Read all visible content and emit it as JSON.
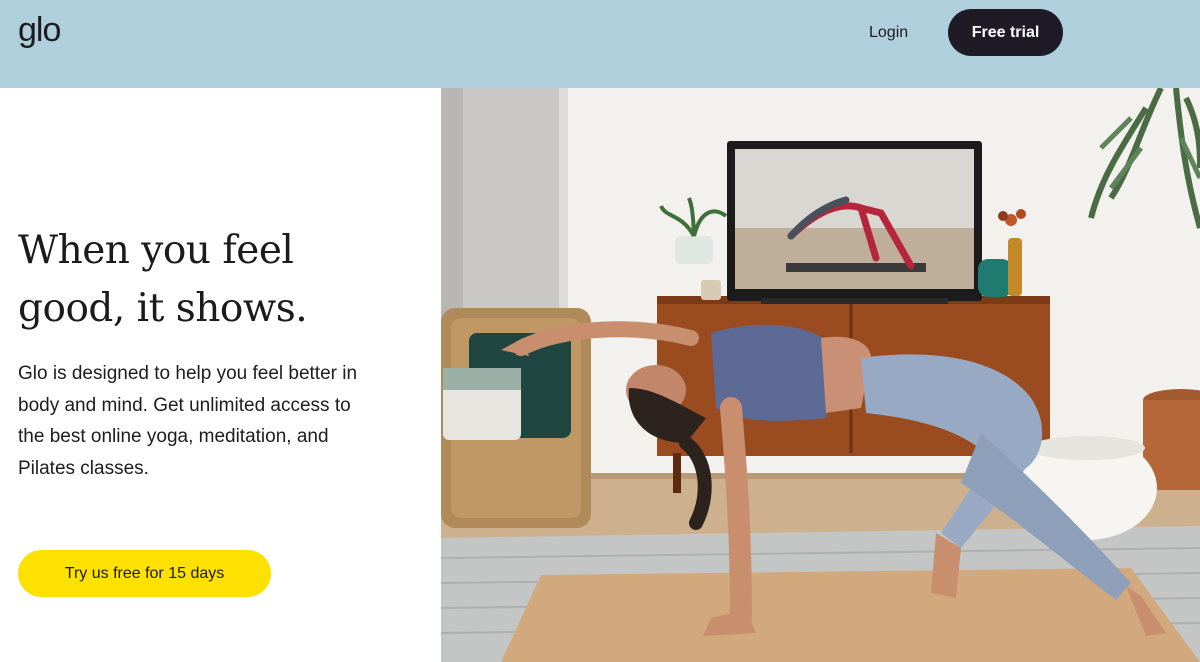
{
  "header": {
    "logo_text": "glo",
    "login_label": "Login",
    "free_trial_label": "Free trial"
  },
  "hero": {
    "headline_line1": "When you feel",
    "headline_line2": "good, it shows.",
    "body": "Glo is designed to help you feel better in body and mind. Get unlimited access to the best online yoga, meditation, and Pilates classes.",
    "cta_label": "Try us free for 15 days"
  },
  "colors": {
    "header_bg": "#b0cfdc",
    "trial_button": "#1e1b27",
    "cta_button": "#ffe100"
  }
}
